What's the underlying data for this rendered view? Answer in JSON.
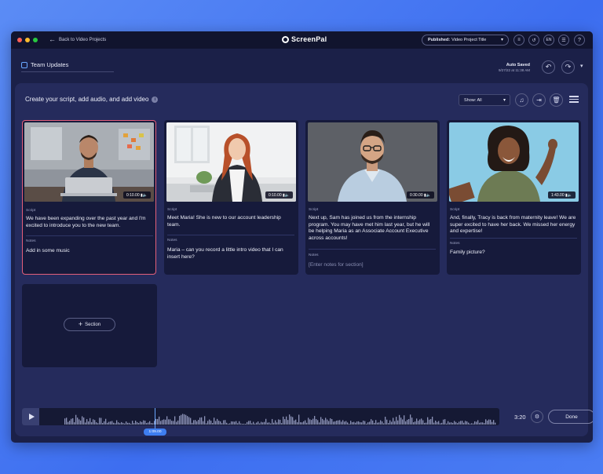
{
  "colors": {
    "window_bg": "#1b2048",
    "panel_bg": "#252b5c",
    "card_bg": "#161a3b",
    "accent_blue": "#3e7ef0",
    "selected_border": "#e35f7a",
    "traffic_red": "#ff5f57",
    "traffic_yellow": "#febc2e",
    "traffic_green": "#28c840"
  },
  "titlebar": {
    "back_label": "Back to Video Projects",
    "back_icon": "arrow-left-icon",
    "app_name": "ScreenPal",
    "publish_status": "Published:",
    "publish_title": "Video Project Title",
    "icons": [
      "checklist-icon",
      "history-icon",
      "language-icon",
      "layers-icon",
      "help-icon"
    ],
    "language_label": "EN",
    "help_label": "?"
  },
  "header": {
    "project_title": "Team Updates",
    "autosave_label": "Auto Saved",
    "autosave_time": "9/27/22 at 11:38 AM"
  },
  "panel": {
    "heading": "Create your script, add audio, and add video",
    "info_glyph": "i",
    "show_filter": "Show: All",
    "add_section_label": "Section"
  },
  "cards": [
    {
      "duration": "0:10.00",
      "script_label": "Script",
      "script": "We have been expanding over the past year and I'm excited to introduce you to the new team.",
      "notes_label": "Notes",
      "notes": "Add in some music",
      "selected": true
    },
    {
      "duration": "0:10.00",
      "script_label": "Script",
      "script": "Meet Maria! She is new to our account leadership team.",
      "notes_label": "Notes",
      "notes": "Maria – can you record a little intro video that I can insert here?",
      "selected": false
    },
    {
      "duration": "0:30.00",
      "script_label": "Script",
      "script": "Next up, Sam has joined us from the internship program. You may have met him last year, but he will be helping Maria as an Associate Account Executive across accounts!",
      "notes_label": "Notes",
      "notes": "[Enter notes for section]",
      "selected": false
    },
    {
      "duration": "1:43.00",
      "script_label": "Script",
      "script": "And, finally, Tracy is back from maternity leave! We are super excited to have her back. We missed her energy and expertise!",
      "notes_label": "Notes",
      "notes": "Family picture?",
      "selected": false
    }
  ],
  "timeline": {
    "playhead_time": "1:09.00",
    "total_time": "3:20",
    "done_label": "Done"
  }
}
